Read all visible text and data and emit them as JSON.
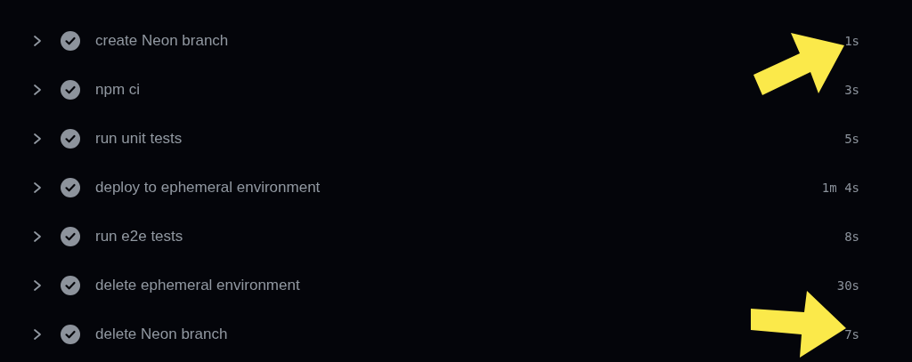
{
  "steps": [
    {
      "name": "create Neon branch",
      "duration": "1s",
      "succeeded": true,
      "expanded": false
    },
    {
      "name": "npm ci",
      "duration": "3s",
      "succeeded": true,
      "expanded": false
    },
    {
      "name": "run unit tests",
      "duration": "5s",
      "succeeded": true,
      "expanded": false
    },
    {
      "name": "deploy to ephemeral environment",
      "duration": "1m 4s",
      "succeeded": true,
      "expanded": false
    },
    {
      "name": "run e2e tests",
      "duration": "8s",
      "succeeded": true,
      "expanded": false
    },
    {
      "name": "delete ephemeral environment",
      "duration": "30s",
      "succeeded": true,
      "expanded": false
    },
    {
      "name": "delete Neon branch",
      "duration": "7s",
      "succeeded": true,
      "expanded": false
    }
  ],
  "callouts": [
    {
      "color": "#fbe94a"
    },
    {
      "color": "#fbe94a"
    }
  ]
}
